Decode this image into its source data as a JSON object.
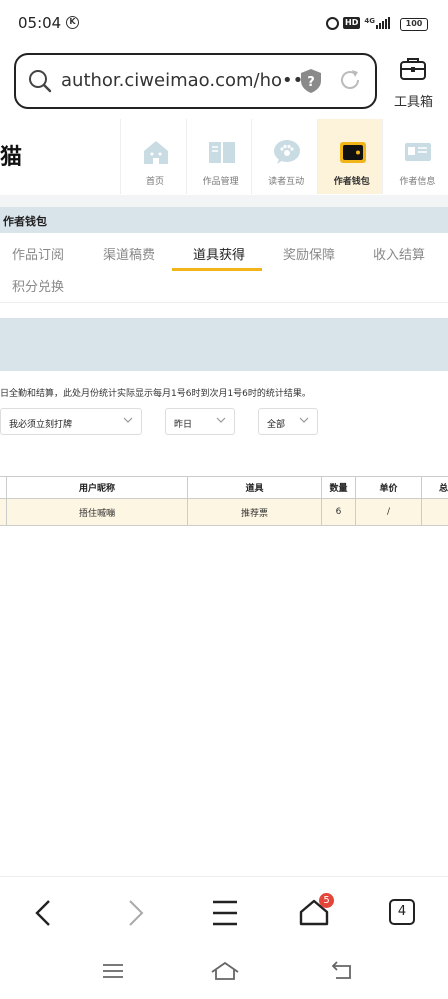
{
  "status_bar": {
    "time": "05:04",
    "network": "4G",
    "battery": "100"
  },
  "url_bar": {
    "url": "author.ciweimao.com/ho•••",
    "toolbox_label": "工具箱"
  },
  "site": {
    "brand_fragment": "猫",
    "nav": [
      {
        "label": "首页",
        "icon": "home-icon"
      },
      {
        "label": "作品管理",
        "icon": "book-icon"
      },
      {
        "label": "读者互动",
        "icon": "paw-icon"
      },
      {
        "label": "作者钱包",
        "icon": "wallet-icon",
        "active": true
      },
      {
        "label": "作者信息",
        "icon": "id-card-icon"
      }
    ],
    "section_title": "作者钱包",
    "tabs": [
      {
        "label": "作品订阅"
      },
      {
        "label": "渠道稿费"
      },
      {
        "label": "道具获得",
        "active": true
      },
      {
        "label": "奖励保障"
      },
      {
        "label": "收入结算"
      },
      {
        "label": "积分兑换"
      }
    ],
    "notice": "日全勤和结算，此处月份统计实际显示每月1号6时到次月1号6时的统计结果。",
    "filters": {
      "book": "我必须立刻打牌",
      "date": "昨日",
      "type": "全部"
    },
    "table": {
      "columns": [
        "用户昵称",
        "道具",
        "数量",
        "单价",
        "总"
      ],
      "rows": [
        {
          "nickname": "捂住嘁嘣",
          "item": "推荐票",
          "quantity": "6",
          "unit_price": "/"
        }
      ]
    }
  },
  "bottom_bar": {
    "tab_count": "4",
    "home_badge": "5"
  }
}
